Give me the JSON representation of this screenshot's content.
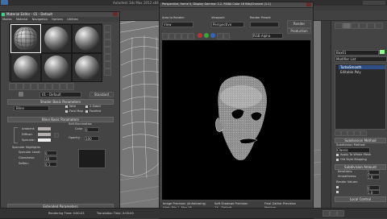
{
  "max_window": {
    "title": "Autodesk 3ds Max 2012 x64",
    "menu": [
      "Edit",
      "Tools",
      "Group",
      "Views",
      "Create",
      "Modifiers",
      "Animation",
      "Graph Editors",
      "Rendering",
      "Customize",
      "MAXScript",
      "Help"
    ]
  },
  "material_editor": {
    "title": "Material Editor - 01 - Default",
    "menu": [
      "Modes",
      "Material",
      "Navigation",
      "Options",
      "Utilities"
    ],
    "material_name": "01 - Default",
    "material_type": "Standard",
    "shader_basic_params_title": "Shader Basic Parameters",
    "shader": "Blinn",
    "wire_label": "Wire",
    "two_sided_label": "2-Sided",
    "face_map_label": "Face Map",
    "faceted_label": "Faceted",
    "blinn_params_title": "Blinn Basic Parameters",
    "self_illum_title": "Self-Illumination",
    "color_label": "Color",
    "color_value": "0",
    "ambient_label": "Ambient:",
    "diffuse_label": "Diffuse:",
    "specular_label": "Specular:",
    "opacity_label": "Opacity:",
    "opacity_value": "100",
    "specular_highlights_title": "Specular Highlights",
    "specular_level_label": "Specular Level:",
    "specular_level_value": "0",
    "glossiness_label": "Glossiness:",
    "glossiness_value": "10",
    "soften_label": "Soften:",
    "soften_value": "0.1",
    "extended_params_title": "Extended Parameters",
    "supersampling_title": "SuperSampling"
  },
  "render_window": {
    "title": "Perspective, frame 0, Display Gamma: 2.2, RGBA Color 16 Bits/Channel (1:1)",
    "area_label": "Area to Render:",
    "area_value": "View",
    "viewport_label": "Viewport:",
    "viewport_value": "Perspective",
    "preset_label": "Render Preset:",
    "preset_value": "",
    "render_button": "Render",
    "production_value": "Production",
    "channel_value": "RGB Alpha",
    "status": {
      "col1_title": "Image Precision (Antialiasing)",
      "col1_value": "High: Min 1, Max 16",
      "col2_title": "Soft Shadows Precision",
      "col2_value": "1X - Default",
      "col3_title": "Final Gather Precision",
      "col3_value": "Medium"
    }
  },
  "command_panel": {
    "object_name": "Box01",
    "modifier_list_label": "Modifier List",
    "stack": [
      "TurboSmooth",
      "Editable Poly"
    ],
    "subdivision_method_title": "Subdivision Method",
    "subdivision_method_label": "Subdivision Method:",
    "subdivision_method_value": "Classic",
    "apply_to_whole_mesh": "Apply To Whole Mesh",
    "old_style_mapping": "Old Style Mapping",
    "subdivision_amount_title": "Subdivision Amount",
    "iterations_label": "Iterations:",
    "iterations_value": "1",
    "smoothness_label": "Smoothness:",
    "smoothness_value": "1.0",
    "render_values_label": "Render Values:",
    "render_iterations_value": "0",
    "render_smoothness_value": "1.0",
    "local_control_title": "Local Control"
  },
  "status_bar": {
    "time_label": "Time:",
    "tag_label": "Add Time Tag",
    "rendering_time_label": "Rendering Time: 0:00:03",
    "translation_time_label": "Translation Time: 0:00:00"
  },
  "colors": {
    "ui_background": "#3a3a3a",
    "panel": "#444444",
    "title_bar": "#3e3e3e",
    "render_canvas": "#000000",
    "wire": "#ffffff",
    "selection": "#2d4f86"
  }
}
